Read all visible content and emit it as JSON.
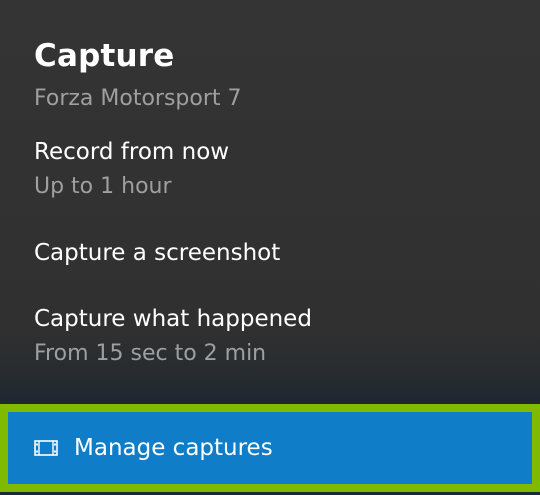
{
  "panel": {
    "title": "Capture",
    "game_name": "Forza Motorsport 7"
  },
  "menu": {
    "record_from_now": {
      "label": "Record from now",
      "sublabel": "Up to 1 hour"
    },
    "capture_screenshot": {
      "label": "Capture a screenshot"
    },
    "capture_what_happened": {
      "label": "Capture what happened",
      "sublabel": "From 15 sec to 2 min"
    }
  },
  "manage": {
    "label": "Manage captures",
    "icon": "film-icon"
  },
  "colors": {
    "focus_border": "#7fba00",
    "button_bg": "#107dc9",
    "panel_bg": "#343434",
    "secondary_text": "#9f9f9f"
  }
}
